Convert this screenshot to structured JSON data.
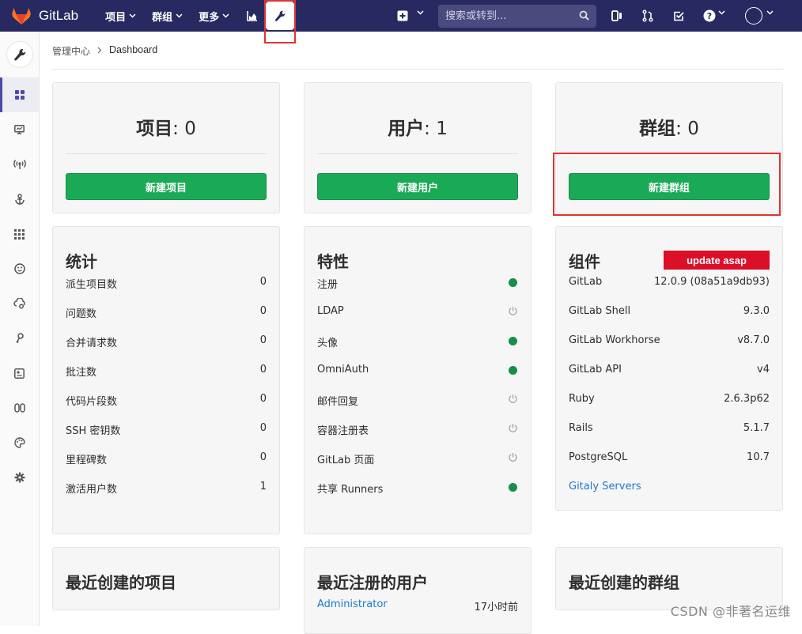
{
  "topnav": {
    "brand": "GitLab",
    "menu": [
      {
        "label": "项目"
      },
      {
        "label": "群组"
      },
      {
        "label": "更多"
      }
    ],
    "search_placeholder": "搜索或转到..."
  },
  "breadcrumb": {
    "parent": "管理中心",
    "current": "Dashboard"
  },
  "summary": [
    {
      "label": "项目",
      "count": ": 0",
      "button": "新建项目"
    },
    {
      "label": "用户",
      "count": ": 1",
      "button": "新建用户"
    },
    {
      "label": "群组",
      "count": ": 0",
      "button": "新建群组"
    }
  ],
  "statistics": {
    "title": "统计",
    "rows": [
      {
        "label": "派生项目数",
        "value": "0"
      },
      {
        "label": "问题数",
        "value": "0"
      },
      {
        "label": "合并请求数",
        "value": "0"
      },
      {
        "label": "批注数",
        "value": "0"
      },
      {
        "label": "代码片段数",
        "value": "0"
      },
      {
        "label": "SSH 密钥数",
        "value": "0"
      },
      {
        "label": "里程碑数",
        "value": "0"
      },
      {
        "label": "激活用户数",
        "value": "1"
      }
    ]
  },
  "features": {
    "title": "特性",
    "rows": [
      {
        "label": "注册",
        "status": "on"
      },
      {
        "label": "LDAP",
        "status": "off"
      },
      {
        "label": "头像",
        "status": "on"
      },
      {
        "label": "OmniAuth",
        "status": "on"
      },
      {
        "label": "邮件回复",
        "status": "off"
      },
      {
        "label": "容器注册表",
        "status": "off"
      },
      {
        "label": "GitLab 页面",
        "status": "off"
      },
      {
        "label": "共享 Runners",
        "status": "on"
      }
    ]
  },
  "components": {
    "title": "组件",
    "badge": "update asap",
    "rows": [
      {
        "label": "GitLab",
        "value": "12.0.9 (08a51a9db93)"
      },
      {
        "label": "GitLab Shell",
        "value": "9.3.0"
      },
      {
        "label": "GitLab Workhorse",
        "value": "v8.7.0"
      },
      {
        "label": "GitLab API",
        "value": "v4"
      },
      {
        "label": "Ruby",
        "value": "2.6.3p62"
      },
      {
        "label": "Rails",
        "value": "5.1.7"
      },
      {
        "label": "PostgreSQL",
        "value": "10.7"
      }
    ],
    "link": "Gitaly Servers"
  },
  "recent": {
    "projects_title": "最近创建的项目",
    "users_title": "最近注册的用户",
    "groups_title": "最近创建的群组",
    "user": {
      "name": "Administrator",
      "time": "17小时前"
    }
  },
  "watermark": "CSDN @非著名运维",
  "colors": {
    "nav": "#292961",
    "green": "#1aaa55",
    "badge": "#db0f28",
    "link": "#1f78d1",
    "highlight": "#e03333"
  }
}
